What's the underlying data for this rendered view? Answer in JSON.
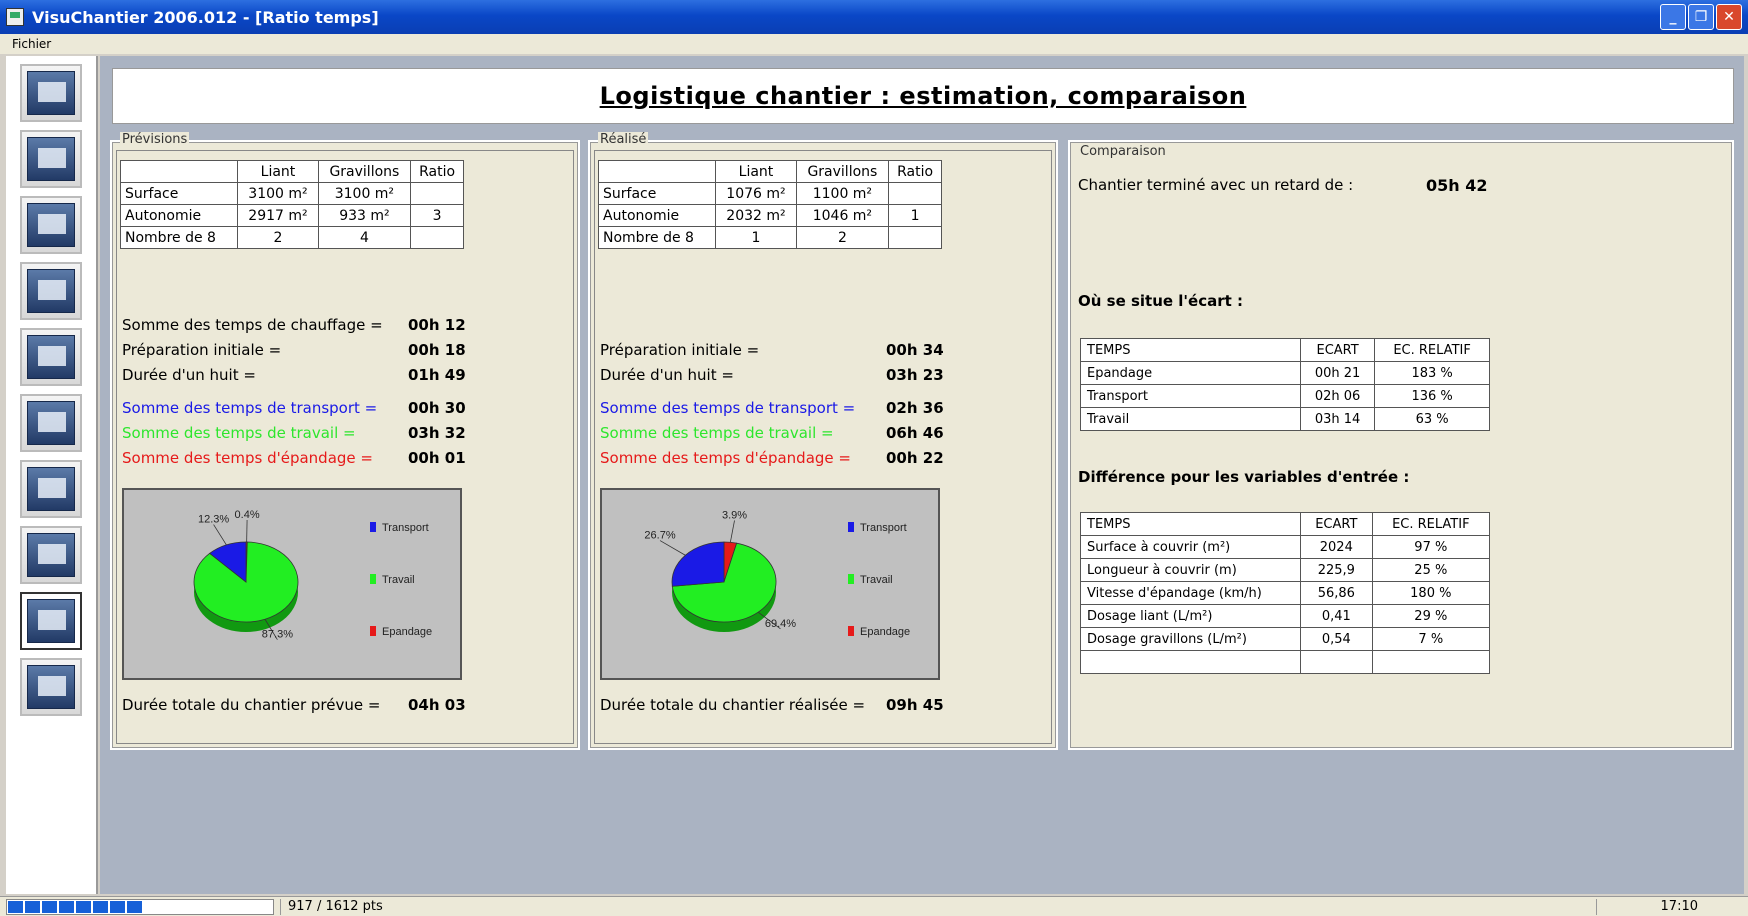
{
  "window": {
    "title": "VisuChantier 2006.012 - [Ratio temps]"
  },
  "menu": {
    "file": "Fichier"
  },
  "toolbar": {
    "buttons": [
      "home-icon",
      "import-icon",
      "folder-icon",
      "save-icon",
      "print-icon",
      "tools-icon",
      "team-icon",
      "site-icon",
      "ratio-chart-icon",
      "stats-icon"
    ]
  },
  "header": {
    "title": "Logistique chantier : estimation, comparaison"
  },
  "previsions": {
    "legend": "Prévisions",
    "table": {
      "headers": [
        "",
        "Liant",
        "Gravillons",
        "Ratio"
      ],
      "rows": [
        [
          "Surface",
          "3100 m²",
          "3100 m²",
          ""
        ],
        [
          "Autonomie",
          "2917 m²",
          "933 m²",
          "3"
        ],
        [
          "Nombre de 8",
          "2",
          "4",
          ""
        ]
      ]
    },
    "chauffage_label": "Somme des temps de chauffage =",
    "chauffage_val": "00h 12",
    "prep_label": "Préparation initiale =",
    "prep_val": "00h 18",
    "huit_label": "Durée d'un huit =",
    "huit_val": "01h 49",
    "transport_label": "Somme des temps de transport =",
    "transport_val": "00h 30",
    "travail_label": "Somme des temps de travail =",
    "travail_val": "03h 32",
    "epandage_label": "Somme des temps d'épandage =",
    "epandage_val": "00h 01",
    "total_label": "Durée totale du chantier prévue =",
    "total_val": "04h 03"
  },
  "realise": {
    "legend": "Réalisé",
    "table": {
      "headers": [
        "",
        "Liant",
        "Gravillons",
        "Ratio"
      ],
      "rows": [
        [
          "Surface",
          "1076 m²",
          "1100 m²",
          ""
        ],
        [
          "Autonomie",
          "2032 m²",
          "1046 m²",
          "1"
        ],
        [
          "Nombre de 8",
          "1",
          "2",
          ""
        ]
      ]
    },
    "prep_label": "Préparation initiale =",
    "prep_val": "00h 34",
    "huit_label": "Durée d'un huit =",
    "huit_val": "03h 23",
    "transport_label": "Somme des temps de transport =",
    "transport_val": "02h 36",
    "travail_label": "Somme des temps de travail =",
    "travail_val": "06h 46",
    "epandage_label": "Somme des temps d'épandage =",
    "epandage_val": "00h 22",
    "total_label": "Durée totale du chantier réalisée =",
    "total_val": "09h 45"
  },
  "chart_data": [
    {
      "type": "pie",
      "series": [
        {
          "name": "Transport",
          "value": 12.3,
          "label": "12.3%"
        },
        {
          "name": "Travail",
          "value": 87.3,
          "label": "87.3%"
        },
        {
          "name": "Epandage",
          "value": 0.4,
          "label": "0.4%"
        }
      ],
      "legend": [
        "Transport",
        "Travail",
        "Epandage"
      ],
      "legend_position": "right",
      "colors": {
        "Transport": "#1a1ae6",
        "Travail": "#22ee22",
        "Epandage": "#e61a1a"
      }
    },
    {
      "type": "pie",
      "series": [
        {
          "name": "Transport",
          "value": 26.7,
          "label": "26.7%"
        },
        {
          "name": "Travail",
          "value": 69.4,
          "label": "69.4%"
        },
        {
          "name": "Epandage",
          "value": 3.9,
          "label": "3.9%"
        }
      ],
      "legend": [
        "Transport",
        "Travail",
        "Epandage"
      ],
      "legend_position": "right",
      "colors": {
        "Transport": "#1a1ae6",
        "Travail": "#22ee22",
        "Epandage": "#e61a1a"
      }
    }
  ],
  "comparaison": {
    "legend": "Comparaison",
    "retard_label": "Chantier terminé avec un retard de :",
    "retard_val": "05h 42",
    "ecart_title": "Où se situe l'écart :",
    "ecart_table": {
      "headers": [
        "TEMPS",
        "ECART",
        "EC. RELATIF"
      ],
      "rows": [
        [
          "Epandage",
          "00h 21",
          "183 %"
        ],
        [
          "Transport",
          "02h 06",
          "136 %"
        ],
        [
          "Travail",
          "03h 14",
          "63 %"
        ]
      ]
    },
    "diff_title": "Différence pour les variables d'entrée :",
    "diff_table": {
      "headers": [
        "TEMPS",
        "ECART",
        "EC. RELATIF"
      ],
      "rows": [
        [
          "Surface à couvrir (m²)",
          "2024",
          "97 %"
        ],
        [
          "Longueur à couvrir (m)",
          "225,9",
          "25 %"
        ],
        [
          "Vitesse d'épandage (km/h)",
          "56,86",
          "180 %"
        ],
        [
          "Dosage liant (L/m²)",
          "0,41",
          "29 %"
        ],
        [
          "Dosage gravillons (L/m²)",
          "0,54",
          "7 %"
        ],
        [
          "",
          "",
          ""
        ]
      ]
    }
  },
  "status": {
    "progress_segments": 8,
    "points": "917 / 1612 pts",
    "time": "17:10"
  }
}
